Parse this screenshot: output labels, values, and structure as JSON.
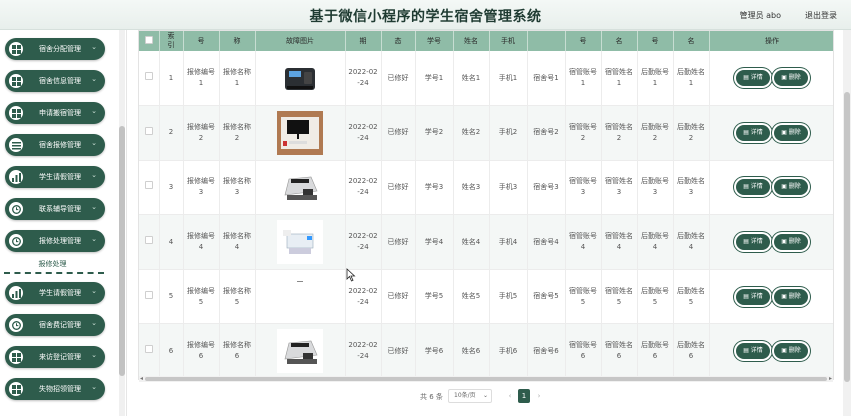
{
  "header": {
    "title": "基于微信小程序的学生宿舍管理系统",
    "user": "管理员 abo",
    "logout": "退出登录"
  },
  "sidebar": {
    "items": [
      {
        "label": "宿舍分配管理",
        "icon": "grid-icon"
      },
      {
        "label": "宿舍信息管理",
        "icon": "grid-icon"
      },
      {
        "label": "申请搬宿管理",
        "icon": "grid-icon"
      },
      {
        "label": "宿舍报修管理",
        "icon": "list-icon"
      },
      {
        "label": "学生请假管理",
        "icon": "chart-icon"
      },
      {
        "label": "联系辅导管理",
        "icon": "clock-icon"
      },
      {
        "label": "报修处理管理",
        "icon": "clock-icon"
      },
      {
        "label": "学生请假管理",
        "icon": "chart-icon"
      },
      {
        "label": "宿舍费记管理",
        "icon": "clock-icon"
      },
      {
        "label": "来访登记管理",
        "icon": "grid-icon"
      },
      {
        "label": "失物招领管理",
        "icon": "grid-icon"
      }
    ],
    "sub_item": "报修处理",
    "arrow": "⌄"
  },
  "table": {
    "headers": [
      "",
      "索引",
      "报修编号",
      "报修名称",
      "故障图片",
      "报修日期",
      "处理状态",
      "学号",
      "姓名",
      "手机",
      "宿舍号",
      "宿管账号",
      "宿管姓名",
      "后勤账号",
      "后勤姓名",
      "操作"
    ],
    "header_display": [
      "",
      "索\n引",
      "号",
      "称",
      "故障图片",
      "期",
      "态",
      "学号",
      "姓名",
      "手机",
      "",
      "号",
      "名",
      "号",
      "名",
      "操作"
    ],
    "rows": [
      {
        "index": "1",
        "no": "报修编号1",
        "name": "报修名称1",
        "img": "printer",
        "date": "2022-02-24",
        "status": "已修好",
        "sid": "学号1",
        "sname": "姓名1",
        "phone": "手机1",
        "room": "宿舍号1",
        "macct": "宿管账号1",
        "mname": "宿管姓名1",
        "lacct": "后勤账号1",
        "lname": "后勤姓名1"
      },
      {
        "index": "2",
        "no": "报修编号2",
        "name": "报修名称2",
        "img": "desk",
        "date": "2022-02-24",
        "status": "已修好",
        "sid": "学号2",
        "sname": "姓名2",
        "phone": "手机2",
        "room": "宿舍号2",
        "macct": "宿管账号2",
        "mname": "宿管姓名2",
        "lacct": "后勤账号2",
        "lname": "后勤姓名2"
      },
      {
        "index": "3",
        "no": "报修编号3",
        "name": "报修名称3",
        "img": "counter",
        "date": "2022-02-24",
        "status": "已修好",
        "sid": "学号3",
        "sname": "姓名3",
        "phone": "手机3",
        "room": "宿舍号3",
        "macct": "宿管账号3",
        "mname": "宿管姓名3",
        "lacct": "后勤账号3",
        "lname": "后勤姓名3"
      },
      {
        "index": "4",
        "no": "报修编号4",
        "name": "报修名称4",
        "img": "copier",
        "date": "2022-02-24",
        "status": "已修好",
        "sid": "学号4",
        "sname": "姓名4",
        "phone": "手机4",
        "room": "宿舍号4",
        "macct": "宿管账号4",
        "mname": "宿管姓名4",
        "lacct": "后勤账号4",
        "lname": "后勤姓名4"
      },
      {
        "index": "5",
        "no": "报修编号5",
        "name": "报修名称5",
        "img": "blank",
        "date": "2022-02-24",
        "status": "已修好",
        "sid": "学号5",
        "sname": "姓名5",
        "phone": "手机5",
        "room": "宿舍号5",
        "macct": "宿管账号5",
        "mname": "宿管姓名5",
        "lacct": "后勤账号5",
        "lname": "后勤姓名5"
      },
      {
        "index": "6",
        "no": "报修编号6",
        "name": "报修名称6",
        "img": "counter",
        "date": "2022-02-24",
        "status": "已修好",
        "sid": "学号6",
        "sname": "姓名6",
        "phone": "手机6",
        "room": "宿舍号6",
        "macct": "宿管账号6",
        "mname": "宿管姓名6",
        "lacct": "后勤账号6",
        "lname": "后勤姓名6"
      }
    ],
    "detail_label": "详情",
    "delete_label": "删除"
  },
  "pager": {
    "total": "共 6 条",
    "size": "10条/页",
    "prev": "‹",
    "page": "1",
    "next": "›"
  },
  "colors": {
    "primary": "#2e5c4c",
    "header_bg": "#8fbca7"
  }
}
